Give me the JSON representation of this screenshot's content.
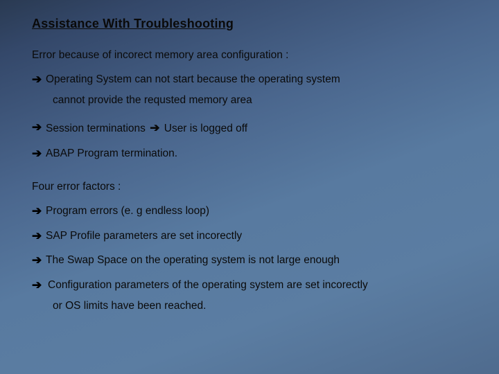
{
  "title": "Assistance With Troubleshooting",
  "intro1": "Error because of incorect memory area configuration :",
  "b1a": "Operating System can not start because the operating system",
  "b1b": "cannot provide the requsted memory area",
  "b2_pre": "Session terminations ",
  "b2_post": " User is logged off",
  "b3": "ABAP Program termination.",
  "intro2": "Four error factors :",
  "f1": "Program errors (e. g endless loop)",
  "f2": "SAP Profile parameters are set incorectly",
  "f3": "The Swap Space on the operating system is not large enough",
  "f4a": " Configuration parameters of the operating system are set incorectly",
  "f4b": "or OS limits have been reached.",
  "arrow_glyph": "➔"
}
